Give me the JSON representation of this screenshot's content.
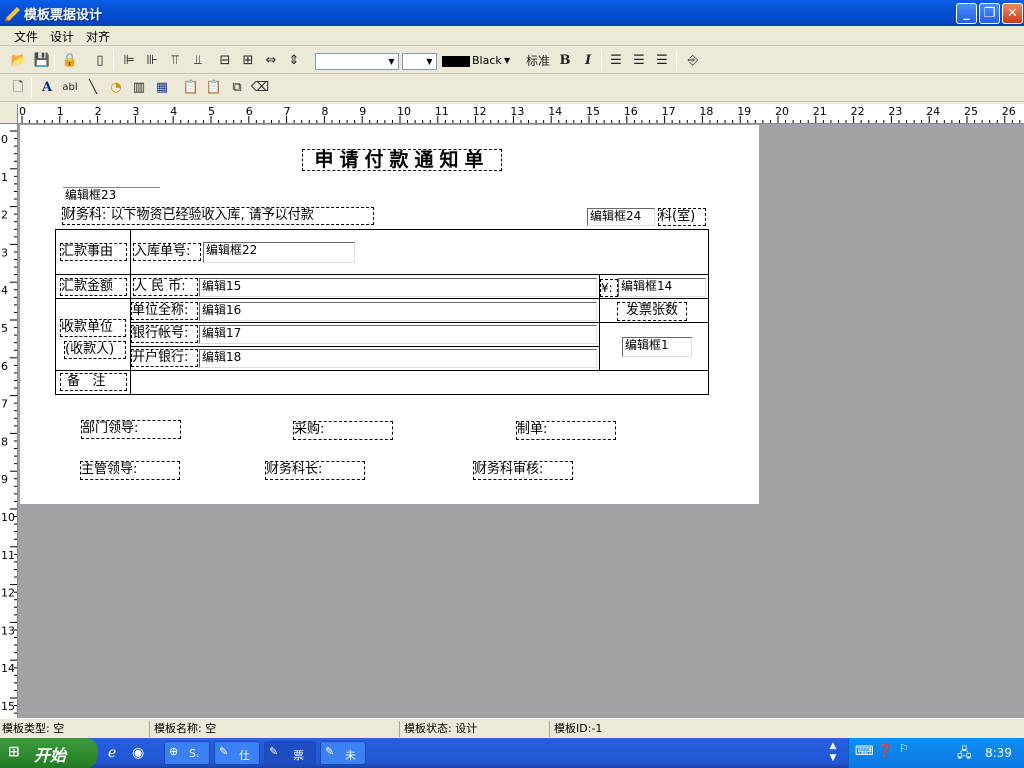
{
  "window": {
    "title": "模板票据设计"
  },
  "menu": {
    "items": [
      "文件",
      "设计",
      "对齐"
    ]
  },
  "toolbar": {
    "font_name": "",
    "font_size": "",
    "color_name": "Black",
    "standard_label": "标准",
    "bold": "B",
    "italic": "I"
  },
  "ruler": {
    "h": [
      "0",
      "1",
      "2",
      "3",
      "4",
      "5",
      "6",
      "7",
      "8",
      "9",
      "10",
      "11",
      "12",
      "13",
      "14",
      "15",
      "16",
      "17",
      "18",
      "19",
      "20",
      "21",
      "22",
      "23",
      "24",
      "25",
      "26"
    ],
    "v": [
      "0",
      "1",
      "2",
      "3",
      "4",
      "5",
      "6",
      "7",
      "8",
      "9",
      "10",
      "11",
      "12",
      "13",
      "14",
      "15"
    ]
  },
  "form": {
    "title": "申请付款通知单",
    "edit23": "编辑框23",
    "finance_note": "财务科: 以下物资已经验收入库, 请予以付款",
    "edit24": "编辑框24",
    "dept_suffix": "科(室)",
    "remit_reason": "汇款事由",
    "stock_no_label": "入库单号:",
    "edit22": "编辑框22",
    "remit_amount": "汇款金额",
    "rmb_label": "人 民 币:",
    "edit15": "编辑15",
    "yen": "¥:",
    "edit14": "编辑框14",
    "payee1": "收款单位",
    "payee2": "(收款人)",
    "unit_full_name": "单位全称:",
    "edit16": "编辑16",
    "invoice_count": "发票张数",
    "bank_account": "银行帐号:",
    "edit17": "编辑17",
    "edit1": "编辑框1",
    "bank_name": "开户银行:",
    "edit18": "编辑18",
    "remark": "备   注",
    "dept_leader": "部门领导:",
    "purchase": "采购:",
    "maker": "制单:",
    "chief_leader": "主管领导:",
    "finance_chief": "财务科长:",
    "finance_review": "财务科审核:"
  },
  "status": {
    "type": "模板类型: 空",
    "name": "模板名称: 空",
    "state": "模板状态: 设计",
    "id": "模板ID:-1"
  },
  "taskbar": {
    "start": "开始",
    "tasks": [
      "S.",
      "仕",
      "票",
      "未"
    ],
    "clock": "8:39"
  }
}
